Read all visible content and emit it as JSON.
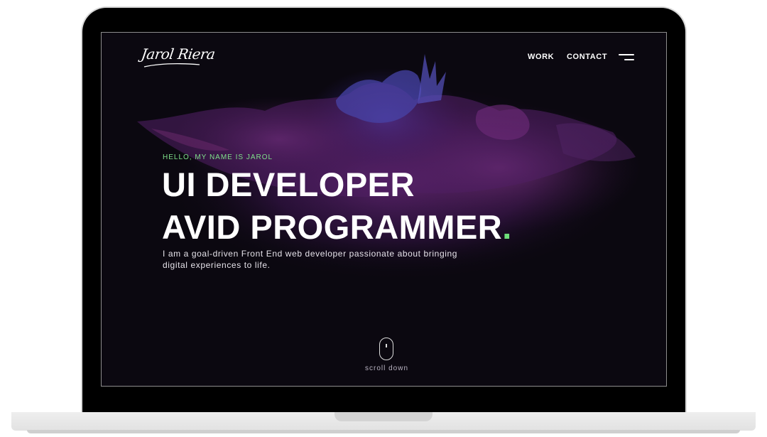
{
  "brand": {
    "logo_text": "Jarol Riera"
  },
  "nav": {
    "work_label": "WORK",
    "contact_label": "CONTACT",
    "menu_icon": "hamburger-menu-icon"
  },
  "hero": {
    "greeting": "HELLO, MY NAME IS JAROL",
    "headline_line1": "UI DEVELOPER",
    "headline_line2": "AVID PROGRAMMER",
    "headline_dot": ".",
    "bio": "I am a goal-driven Front End web developer passionate about bringing digital experiences to life."
  },
  "scroll": {
    "label": "scroll down",
    "icon": "mouse-icon"
  },
  "colors": {
    "background": "#0b0810",
    "accent_green": "#6ee07a",
    "splash_purple": "#6d2a8a",
    "splash_blue": "#3b3ea8",
    "text": "#ffffff"
  }
}
